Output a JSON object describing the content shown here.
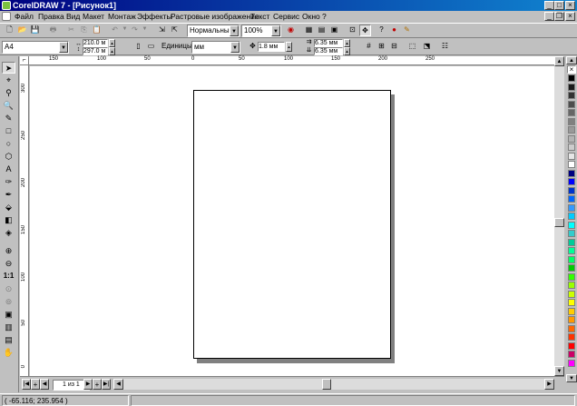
{
  "window": {
    "title": "CorelDRAW 7 - [Рисунок1]"
  },
  "menu": [
    "Файл",
    "Правка",
    "Вид",
    "Макет",
    "Монтаж",
    "Эффекты",
    "Растровые изображения",
    "Текст",
    "Сервис",
    "Окно",
    "?"
  ],
  "toolbar": {
    "view_mode": "Нормальный",
    "zoom": "100%"
  },
  "property_bar": {
    "paper": "A4",
    "width": "210.0 м",
    "height": "297.0 м",
    "units_label": "Единицы:",
    "units_value": "мм",
    "nudge": "1.8 мм",
    "dup_x": "6.35 мм",
    "dup_y": "6.35 мм"
  },
  "ruler_h_labels": [
    "150",
    "100",
    "50",
    "0",
    "50",
    "100",
    "150",
    "200",
    "250"
  ],
  "ruler_v_labels": [
    "300",
    "250",
    "200",
    "150",
    "100",
    "50",
    "0"
  ],
  "page_nav": {
    "label": "1 из 1"
  },
  "status": {
    "coords": "( -65.116; 235.954 )"
  },
  "palette": [
    "#000000",
    "#1a1a1a",
    "#333333",
    "#4d4d4d",
    "#666666",
    "#808080",
    "#999999",
    "#b3b3b3",
    "#cccccc",
    "#e6e6e6",
    "#ffffff",
    "#000080",
    "#0000ff",
    "#0033cc",
    "#0066ff",
    "#3399ff",
    "#00ccff",
    "#00ffff",
    "#33cccc",
    "#00cc99",
    "#00ff99",
    "#00ff66",
    "#00cc00",
    "#33ff00",
    "#99ff00",
    "#ccff00",
    "#ffff00",
    "#ffcc00",
    "#ff9900",
    "#ff6600",
    "#ff3300",
    "#ff0000",
    "#cc0066",
    "#ff00ff"
  ]
}
